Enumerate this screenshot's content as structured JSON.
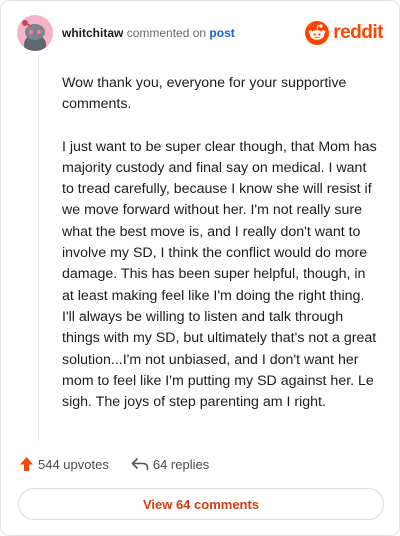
{
  "header": {
    "username": "whitchitaw",
    "action_text": "commented on",
    "post_link": "post",
    "brand": "reddit"
  },
  "comment": {
    "paragraphs": [
      "Wow thank you, everyone for your supportive comments.",
      "I just want to be super clear though, that Mom has majority custody and final say on medical. I want to tread carefully, because I know she will resist if we move forward without her. I'm not really sure what the best move is, and I really don't want to involve my SD, I think the conflict would do more damage. This has been super helpful, though, in at least making feel like I'm doing the right thing. I'll always be willing to listen and talk through things with my SD, but ultimately that's not a great solution...I'm not unbiased, and I don't want her mom to feel like I'm putting my SD against her. Le sigh. The joys of step parenting am I right."
    ]
  },
  "footer": {
    "upvotes": "544 upvotes",
    "replies": "64 replies",
    "view_comments": "View 64 comments"
  },
  "colors": {
    "brand": "#ff4500",
    "link": "#1a5fd0",
    "button_text": "#d33d11",
    "avatar_bg": "#f5b3c7"
  },
  "icons": {
    "avatar": "snoo-avatar-icon",
    "logo": "reddit-snoo-icon",
    "upvote": "upvote-arrow-icon",
    "reply": "reply-arrow-icon"
  }
}
